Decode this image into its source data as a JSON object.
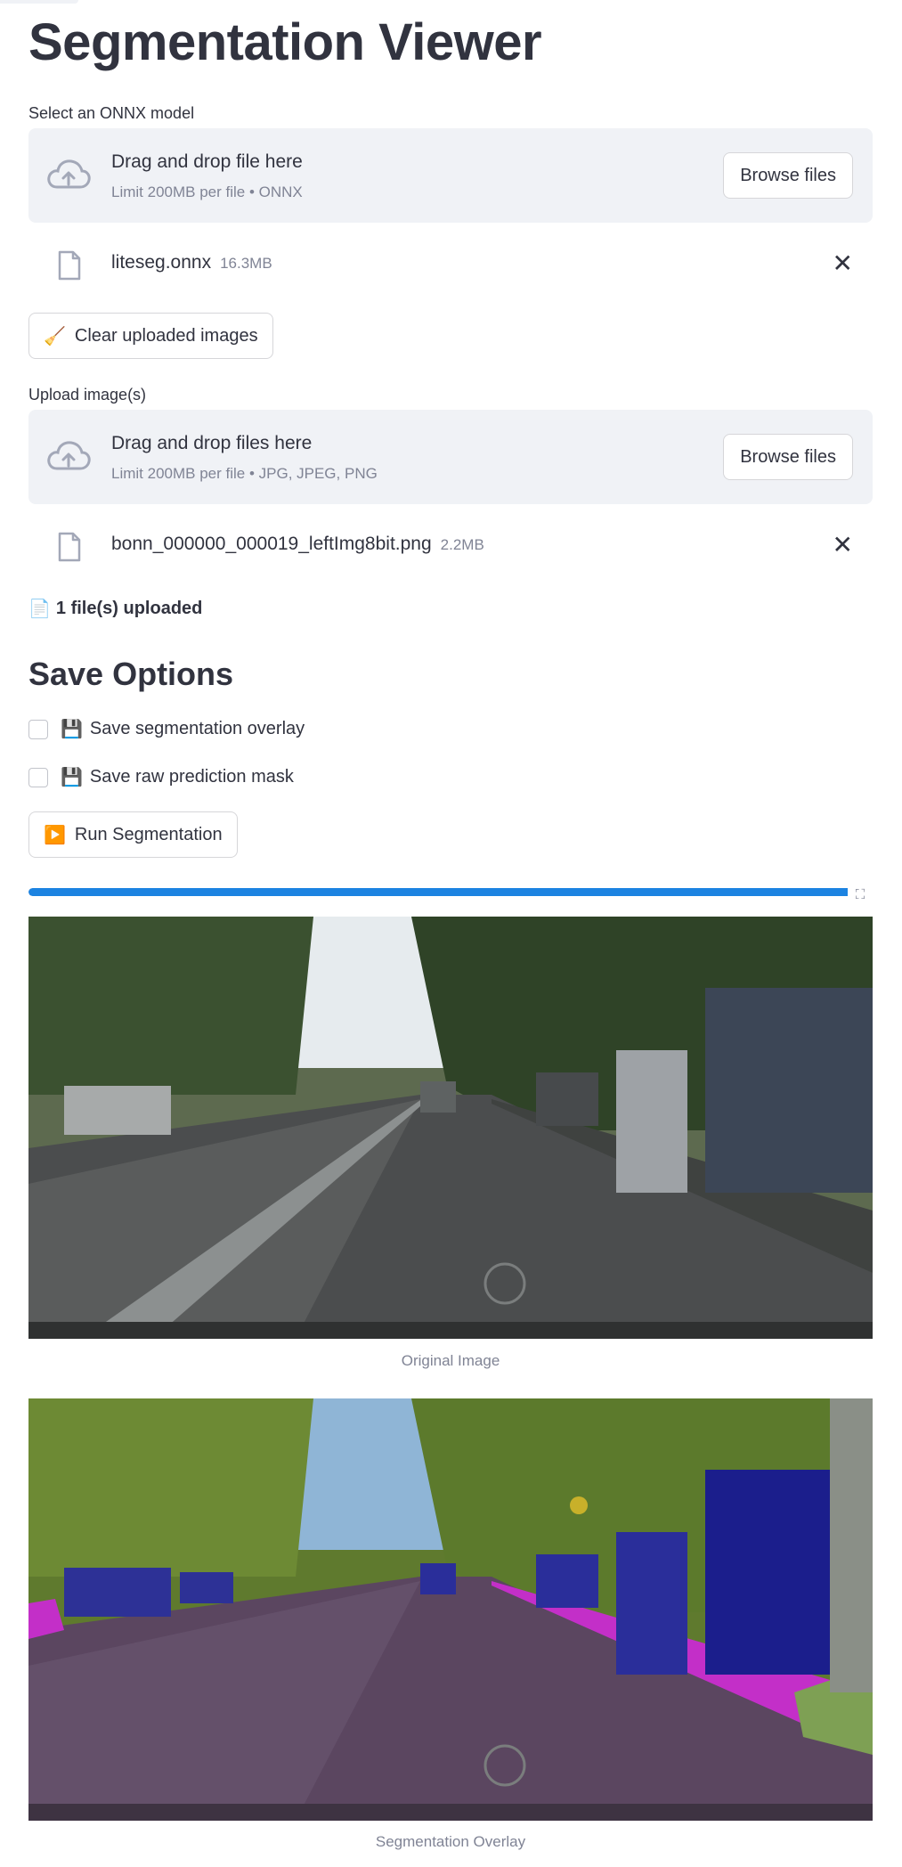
{
  "page": {
    "title": "Segmentation Viewer"
  },
  "model_uploader": {
    "label": "Select an ONNX model",
    "drop_title": "Drag and drop file here",
    "drop_limit": "Limit 200MB per file • ONNX",
    "browse_label": "Browse files",
    "file": {
      "name": "liteseg.onnx",
      "size": "16.3MB"
    }
  },
  "clear_button": {
    "icon": "broom-emoji",
    "glyph": "🧹",
    "label": "Clear uploaded images"
  },
  "image_uploader": {
    "label": "Upload image(s)",
    "drop_title": "Drag and drop files here",
    "drop_limit": "Limit 200MB per file • JPG, JPEG, PNG",
    "browse_label": "Browse files",
    "file": {
      "name": "bonn_000000_000019_leftImg8bit.png",
      "size": "2.2MB"
    }
  },
  "upload_status": {
    "icon": "page-emoji",
    "glyph": "📄",
    "text": "1 file(s) uploaded"
  },
  "save_options": {
    "heading": "Save Options",
    "overlay": {
      "glyph": "💾",
      "label": "Save segmentation overlay",
      "checked": false
    },
    "mask": {
      "glyph": "💾",
      "label": "Save raw prediction mask",
      "checked": false
    }
  },
  "run_button": {
    "glyph": "▶️",
    "label": "Run Segmentation"
  },
  "progress": {
    "fraction": 1.0,
    "color": "#1c83e1"
  },
  "images": {
    "original_caption": "Original Image",
    "overlay_caption": "Segmentation Overlay"
  },
  "colors": {
    "accent": "#1c83e1",
    "dropzone_bg": "#f0f2f6",
    "seg_vehicle": "#1b1e8c",
    "seg_sidewalk": "#c32fc8",
    "seg_road": "#5b4660",
    "seg_vegetation": "#5f7a2e",
    "seg_sky": "#8fb5d6"
  }
}
